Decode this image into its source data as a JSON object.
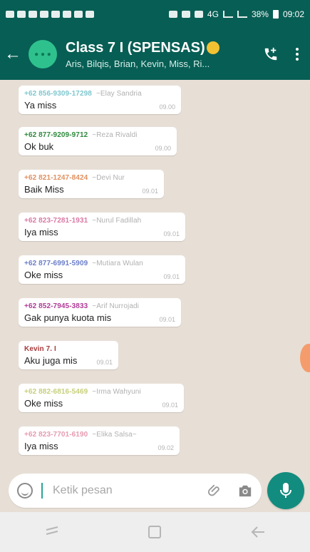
{
  "status_bar": {
    "battery": "38%",
    "time": "09:02",
    "net": "4G"
  },
  "header": {
    "back_label": "←",
    "title": "Class 7 I (SPENSAS)",
    "subtitle": "Aris, Bilqis, Brian, Kevin, Miss, Ri..."
  },
  "messages": [
    {
      "sender": "+62 856-9309-17298",
      "alias": "~Elay Sandria",
      "text": "Ya miss",
      "time": "09.00",
      "sender_color": "#7fc7cf"
    },
    {
      "sender": "+62 877-9209-9712",
      "alias": "~Reza Rivaldi",
      "text": "Ok buk",
      "time": "09.00",
      "sender_color": "#2f8a3d"
    },
    {
      "sender": "+62 821-1247-8424",
      "alias": "~Devi Nur",
      "text": "Baik Miss",
      "time": "09.01",
      "sender_color": "#e09060"
    },
    {
      "sender": "+62 823-7281-1931",
      "alias": "~Nurul Fadillah",
      "text": "Iya miss",
      "time": "09.01",
      "sender_color": "#d97aa5"
    },
    {
      "sender": "+62 877-6991-5909",
      "alias": "~Mutiara Wulan",
      "text": "Oke miss",
      "time": "09.01",
      "sender_color": "#6a7ec9"
    },
    {
      "sender": "+62 852-7945-3833",
      "alias": "~Arif Nurrojadi",
      "text": "Gak punya kuota mis",
      "time": "09.01",
      "sender_color": "#b03b98"
    },
    {
      "sender": "Kevin 7. I",
      "alias": "",
      "text": "Aku juga mis",
      "time": "09.01",
      "sender_color": "#a83a3a"
    },
    {
      "sender": "+62 882-6816-5469",
      "alias": "~Irma Wahyuni",
      "text": "Oke miss",
      "time": "09.01",
      "sender_color": "#c8cf7a"
    },
    {
      "sender": "+62 823-7701-6190",
      "alias": "~Elika Salsa~",
      "text": "Iya miss",
      "time": "09.02",
      "sender_color": "#e79ab0"
    }
  ],
  "composer": {
    "placeholder": "Ketik pesan"
  },
  "icons": {
    "back": "back-arrow-icon",
    "add_call": "add-call-icon",
    "menu": "more-vertical-icon",
    "emoji": "emoji-icon",
    "attach": "paperclip-icon",
    "camera": "camera-icon",
    "mic": "microphone-icon"
  },
  "colors": {
    "header": "#075e54",
    "accent": "#128c7e",
    "chat_bg": "#e7dfd6"
  }
}
